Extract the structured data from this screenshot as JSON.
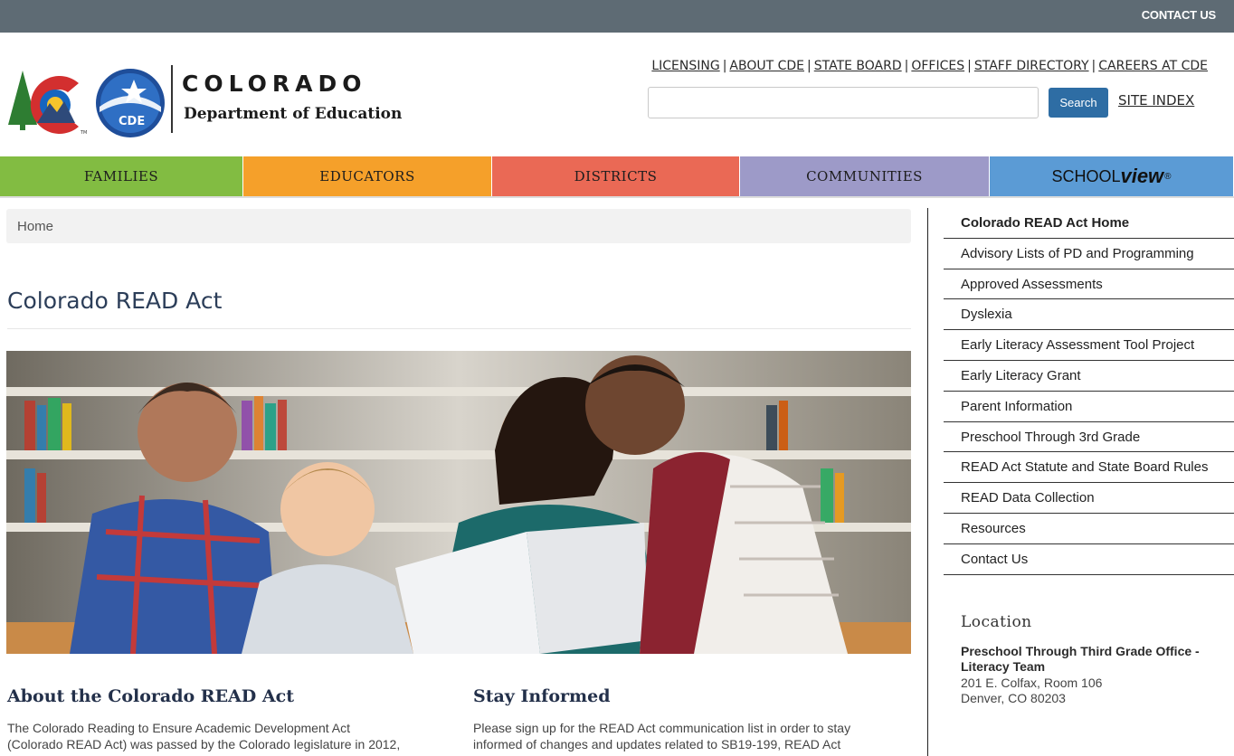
{
  "topbar": {
    "contact_label": "CONTACT US"
  },
  "header": {
    "brand_line1": "COLORADO",
    "brand_line2": "Department of Education",
    "badge_text": "CDE",
    "util_links": [
      "LICENSING",
      "ABOUT CDE",
      "STATE BOARD",
      "OFFICES",
      "STAFF DIRECTORY",
      "CAREERS AT CDE"
    ],
    "search_placeholder": "",
    "search_button": "Search",
    "site_index": "SITE INDEX"
  },
  "nav": {
    "families": "FAMILIES",
    "educators": "EDUCATORS",
    "districts": "DISTRICTS",
    "communities": "COMMUNITIES",
    "schoolview_a": "SCHOOL",
    "schoolview_b": "view",
    "schoolview_reg": "®"
  },
  "breadcrumb": {
    "home": "Home"
  },
  "page": {
    "title": "Colorado READ Act"
  },
  "about": {
    "heading": "About the Colorado READ Act",
    "line1": "The Colorado Reading to Ensure Academic Development Act",
    "line2": "(Colorado READ Act) was passed by the Colorado legislature in 2012,"
  },
  "stay": {
    "heading": "Stay Informed",
    "line1": "Please sign up for the READ Act communication list in order to stay",
    "line2": "informed of changes and updates related to SB19-199, READ Act"
  },
  "sidebar": {
    "items": [
      "Colorado READ Act Home",
      "Advisory Lists of PD and Programming",
      "Approved Assessments",
      "Dyslexia",
      "Early Literacy Assessment Tool Project",
      "Early Literacy Grant",
      "Parent Information",
      "Preschool Through 3rd Grade",
      "READ Act Statute and State Board Rules",
      "READ Data Collection",
      "Resources",
      "Contact Us"
    ],
    "location_title": "Location",
    "location_name": "Preschool Through Third Grade Office - Literacy Team",
    "address1": "201 E. Colfax, Room 106",
    "address2": "Denver, CO 80203"
  },
  "colors": {
    "families": "#82bc42",
    "educators": "#f5a02a",
    "districts": "#ea6955",
    "communities": "#9d9ac8",
    "schoolview": "#5b9bd5",
    "topbar": "#5e6b74",
    "search_button": "#2e6da4"
  }
}
